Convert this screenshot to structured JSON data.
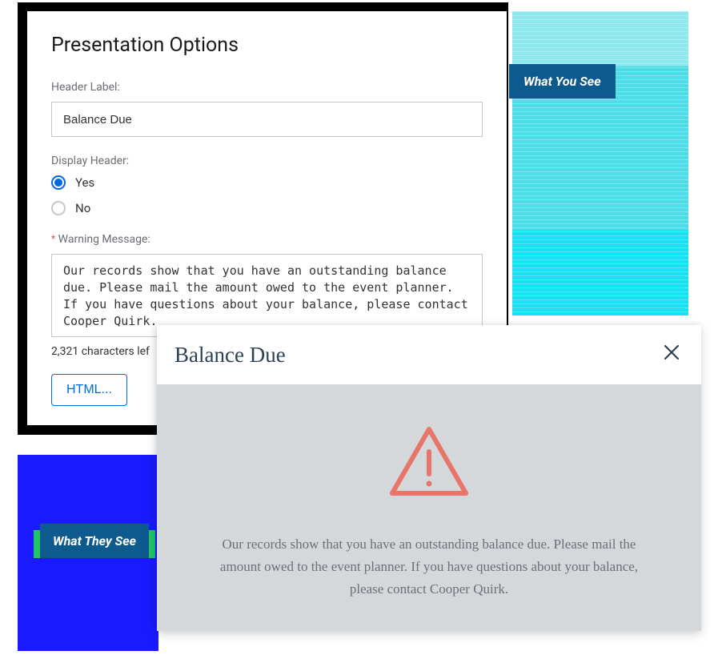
{
  "panel": {
    "title": "Presentation Options",
    "header_label_field": "Header Label:",
    "header_label_value": "Balance Due",
    "display_header_field": "Display Header:",
    "radio_yes": "Yes",
    "radio_no": "No",
    "display_header_selected": "Yes",
    "warning_field_label": "Warning Message:",
    "warning_value": "Our records show that you have an outstanding balance due. Please mail the amount owed to the event planner. If you have questions about your balance, please contact Cooper Quirk.",
    "char_count": "2,321 characters lef",
    "html_button": "HTML..."
  },
  "badges": {
    "what_you_see": "What You See",
    "what_they_see": "What They See"
  },
  "modal": {
    "title": "Balance Due",
    "message": "Our records show that you have an outstanding balance due. Please mail the amount owed to the event planner. If you have questions about your balance, please contact Cooper Quirk."
  }
}
